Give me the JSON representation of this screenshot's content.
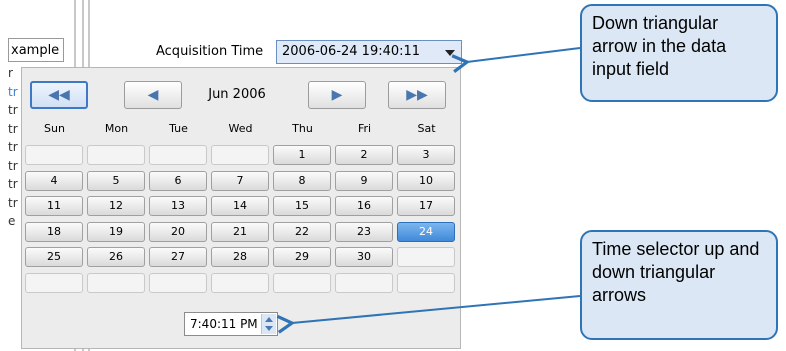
{
  "app": {
    "example_tab": "xample",
    "left_stubs": [
      {
        "text": "r",
        "blue": false
      },
      {
        "text": "tr",
        "blue": true
      },
      {
        "text": "tr",
        "blue": false
      },
      {
        "text": "tr",
        "blue": false
      },
      {
        "text": "tr",
        "blue": false
      },
      {
        "text": "tr",
        "blue": false
      },
      {
        "text": "tr",
        "blue": false
      },
      {
        "text": "tr",
        "blue": false
      },
      {
        "text": "e",
        "blue": false
      }
    ],
    "acquisition_label": "Acquisition Time",
    "acquisition_value": "2006-06-24 19:40:11"
  },
  "calendar": {
    "month_label": "Jun 2006",
    "nav": {
      "prev_year": "◀◀",
      "prev_month": "◀",
      "next_month": "▶",
      "next_year": "▶▶"
    },
    "weekdays": [
      "Sun",
      "Mon",
      "Tue",
      "Wed",
      "Thu",
      "Fri",
      "Sat"
    ],
    "weeks": [
      [
        "",
        "",
        "",
        "",
        "1",
        "2",
        "3"
      ],
      [
        "4",
        "5",
        "6",
        "7",
        "8",
        "9",
        "10"
      ],
      [
        "11",
        "12",
        "13",
        "14",
        "15",
        "16",
        "17"
      ],
      [
        "18",
        "19",
        "20",
        "21",
        "22",
        "23",
        "24"
      ],
      [
        "25",
        "26",
        "27",
        "28",
        "29",
        "30",
        ""
      ],
      [
        "",
        "",
        "",
        "",
        "",
        "",
        ""
      ]
    ],
    "selected_day": "24",
    "time_value": "7:40:11 PM"
  },
  "callouts": {
    "dropdown_arrow": "Down triangular arrow in the data input field",
    "time_spinner": "Time selector up and down triangular arrows"
  },
  "colors": {
    "callout_border": "#2f74b5",
    "callout_fill": "#dbe7f4",
    "selected_day": "#3f8ad9"
  }
}
